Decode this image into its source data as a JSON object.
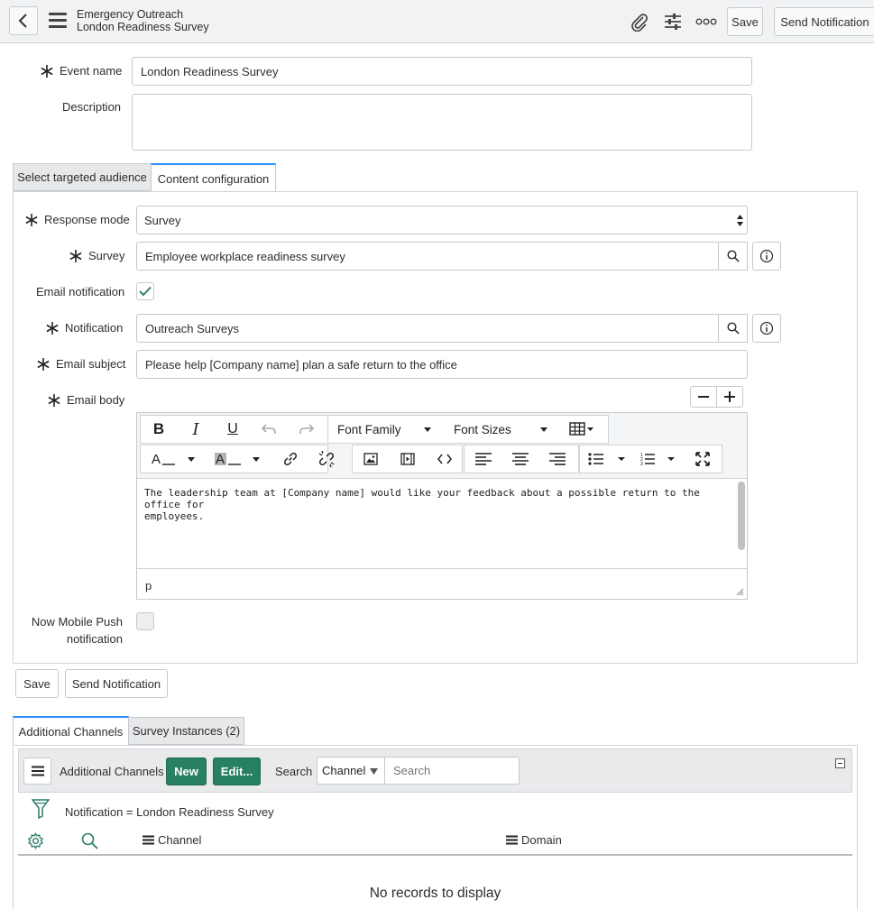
{
  "header": {
    "breadcrumb_parent": "Emergency Outreach",
    "record_title": "London Readiness Survey",
    "save_label": "Save",
    "send_label": "Send Notification"
  },
  "form": {
    "event_name_label": "Event name",
    "event_name_value": "London Readiness Survey",
    "description_label": "Description",
    "description_value": ""
  },
  "tabs": [
    {
      "label": "Select targeted audience"
    },
    {
      "label": "Content configuration"
    }
  ],
  "content": {
    "response_mode_label": "Response mode",
    "response_mode_value": "Survey",
    "survey_label": "Survey",
    "survey_value": "Employee workplace readiness survey",
    "email_notification_label": "Email notification",
    "email_notification_checked": true,
    "notification_label": "Notification",
    "notification_value": "Outreach Surveys",
    "email_subject_label": "Email subject",
    "email_subject_value": "Please help [Company name] plan a safe return to the office",
    "email_body_label": "Email body",
    "mobile_push_label_1": "Now Mobile Push",
    "mobile_push_label_2": "notification",
    "mobile_push_checked": false
  },
  "editor": {
    "font_family_label": "Font Family",
    "font_sizes_label": "Font Sizes",
    "body_line1": "The leadership team at [Company name] would like your feedback about a possible return to the office for",
    "body_line2": "employees.",
    "status_path": "p"
  },
  "form_buttons": {
    "save_label": "Save",
    "send_label": "Send Notification"
  },
  "related": {
    "tabs": [
      {
        "label": "Additional Channels"
      },
      {
        "label": "Survey Instances (2)"
      }
    ],
    "list_title": "Additional Channels",
    "new_label": "New",
    "edit_label": "Edit...",
    "search_label": "Search",
    "search_field": "Channel",
    "search_placeholder": "Search",
    "filter_text": "Notification = London Readiness Survey",
    "columns": [
      "Channel",
      "Domain"
    ],
    "empty_message": "No records to display"
  },
  "colors": {
    "accent_blue": "#278efc",
    "brand_green": "#278060",
    "check_green": "#2e7d6b"
  }
}
